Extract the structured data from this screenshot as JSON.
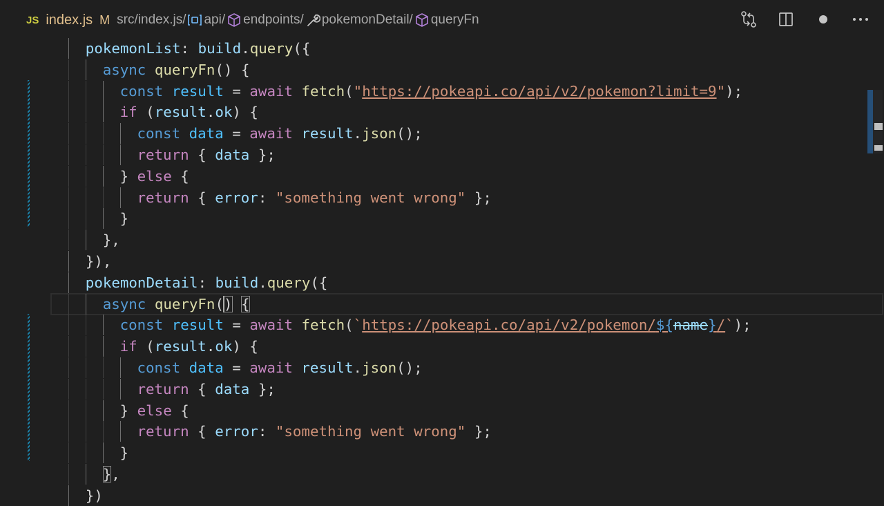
{
  "breadcrumb": {
    "lang_badge": "JS",
    "file_name": "index.js",
    "modified_flag": "M",
    "path": "src/index.js/",
    "segments": [
      {
        "icon": "variable-icon",
        "label": "api/"
      },
      {
        "icon": "cube-icon",
        "label": "endpoints/"
      },
      {
        "icon": "wrench-icon",
        "label": "pokemonDetail/"
      },
      {
        "icon": "cube-icon",
        "label": "queryFn"
      }
    ]
  },
  "toolbar": {
    "icons": [
      "compare-changes-icon",
      "split-editor-icon",
      "unsaved-dot-icon",
      "more-actions-icon"
    ]
  },
  "code": {
    "indent_unit": "  ",
    "lines": [
      {
        "indent": 2,
        "tokens": [
          [
            "v",
            "pokemonList"
          ],
          [
            "p",
            ": "
          ],
          [
            "v",
            "build"
          ],
          [
            "p",
            "."
          ],
          [
            "f",
            "query"
          ],
          [
            "p",
            "({"
          ]
        ]
      },
      {
        "indent": 3,
        "tokens": [
          [
            "k",
            "async "
          ],
          [
            "f",
            "queryFn"
          ],
          [
            "p",
            "() {"
          ]
        ]
      },
      {
        "indent": 4,
        "tokens": [
          [
            "k",
            "const "
          ],
          [
            "cn",
            "result"
          ],
          [
            "p",
            " = "
          ],
          [
            "c",
            "await "
          ],
          [
            "f",
            "fetch"
          ],
          [
            "p",
            "("
          ],
          [
            "s",
            "\""
          ],
          [
            "s-link",
            "https://pokeapi.co/api/v2/pokemon?limit=9"
          ],
          [
            "s",
            "\""
          ],
          [
            "p",
            ");"
          ]
        ]
      },
      {
        "indent": 4,
        "tokens": [
          [
            "c",
            "if "
          ],
          [
            "p",
            "("
          ],
          [
            "v",
            "result"
          ],
          [
            "p",
            "."
          ],
          [
            "v",
            "ok"
          ],
          [
            "p",
            ") {"
          ]
        ]
      },
      {
        "indent": 5,
        "tokens": [
          [
            "k",
            "const "
          ],
          [
            "cn",
            "data"
          ],
          [
            "p",
            " = "
          ],
          [
            "c",
            "await "
          ],
          [
            "v",
            "result"
          ],
          [
            "p",
            "."
          ],
          [
            "f",
            "json"
          ],
          [
            "p",
            "();"
          ]
        ]
      },
      {
        "indent": 5,
        "tokens": [
          [
            "c",
            "return "
          ],
          [
            "p",
            "{ "
          ],
          [
            "v",
            "data"
          ],
          [
            "p",
            " };"
          ]
        ]
      },
      {
        "indent": 4,
        "tokens": [
          [
            "p",
            "} "
          ],
          [
            "c",
            "else "
          ],
          [
            "p",
            "{"
          ]
        ]
      },
      {
        "indent": 5,
        "tokens": [
          [
            "c",
            "return "
          ],
          [
            "p",
            "{ "
          ],
          [
            "v",
            "error"
          ],
          [
            "p",
            ": "
          ],
          [
            "s",
            "\"something went wrong\""
          ],
          [
            "p",
            " };"
          ]
        ]
      },
      {
        "indent": 4,
        "tokens": [
          [
            "p",
            "}"
          ]
        ]
      },
      {
        "indent": 3,
        "tokens": [
          [
            "p",
            "},"
          ]
        ]
      },
      {
        "indent": 2,
        "tokens": [
          [
            "p",
            "}),"
          ]
        ]
      },
      {
        "indent": 2,
        "tokens": [
          [
            "v",
            "pokemonDetail"
          ],
          [
            "p",
            ": "
          ],
          [
            "v",
            "build"
          ],
          [
            "p",
            "."
          ],
          [
            "f",
            "query"
          ],
          [
            "p",
            "({"
          ]
        ]
      },
      {
        "indent": 3,
        "current": true,
        "tokens": [
          [
            "k",
            "async "
          ],
          [
            "f",
            "queryFn"
          ],
          [
            "p",
            "("
          ],
          [
            "p-br",
            ")"
          ],
          [
            "p",
            " "
          ],
          [
            "p-br",
            "{"
          ]
        ]
      },
      {
        "indent": 4,
        "tokens": [
          [
            "k",
            "const "
          ],
          [
            "cn",
            "result"
          ],
          [
            "p",
            " = "
          ],
          [
            "c",
            "await "
          ],
          [
            "f",
            "fetch"
          ],
          [
            "p",
            "("
          ],
          [
            "s",
            "`"
          ],
          [
            "s-link",
            "https://pokeapi.co/api/v2/pokemon/"
          ],
          [
            "k-link",
            "${"
          ],
          [
            "sk",
            "name"
          ],
          [
            "k-link",
            "}"
          ],
          [
            "s-link",
            "/"
          ],
          [
            "s",
            "`"
          ],
          [
            "p",
            ");"
          ]
        ]
      },
      {
        "indent": 4,
        "tokens": [
          [
            "c",
            "if "
          ],
          [
            "p",
            "("
          ],
          [
            "v",
            "result"
          ],
          [
            "p",
            "."
          ],
          [
            "v",
            "ok"
          ],
          [
            "p",
            ") {"
          ]
        ]
      },
      {
        "indent": 5,
        "tokens": [
          [
            "k",
            "const "
          ],
          [
            "cn",
            "data"
          ],
          [
            "p",
            " = "
          ],
          [
            "c",
            "await "
          ],
          [
            "v",
            "result"
          ],
          [
            "p",
            "."
          ],
          [
            "f",
            "json"
          ],
          [
            "p",
            "();"
          ]
        ]
      },
      {
        "indent": 5,
        "tokens": [
          [
            "c",
            "return "
          ],
          [
            "p",
            "{ "
          ],
          [
            "v",
            "data"
          ],
          [
            "p",
            " };"
          ]
        ]
      },
      {
        "indent": 4,
        "tokens": [
          [
            "p",
            "} "
          ],
          [
            "c",
            "else "
          ],
          [
            "p",
            "{"
          ]
        ]
      },
      {
        "indent": 5,
        "tokens": [
          [
            "c",
            "return "
          ],
          [
            "p",
            "{ "
          ],
          [
            "v",
            "error"
          ],
          [
            "p",
            ": "
          ],
          [
            "s",
            "\"something went wrong\""
          ],
          [
            "p",
            " };"
          ]
        ]
      },
      {
        "indent": 4,
        "tokens": [
          [
            "p",
            "}"
          ]
        ]
      },
      {
        "indent": 3,
        "tokens": [
          [
            "p-br",
            "}"
          ],
          [
            "p",
            ","
          ]
        ]
      },
      {
        "indent": 2,
        "tokens": [
          [
            "p",
            "})"
          ]
        ]
      }
    ]
  }
}
